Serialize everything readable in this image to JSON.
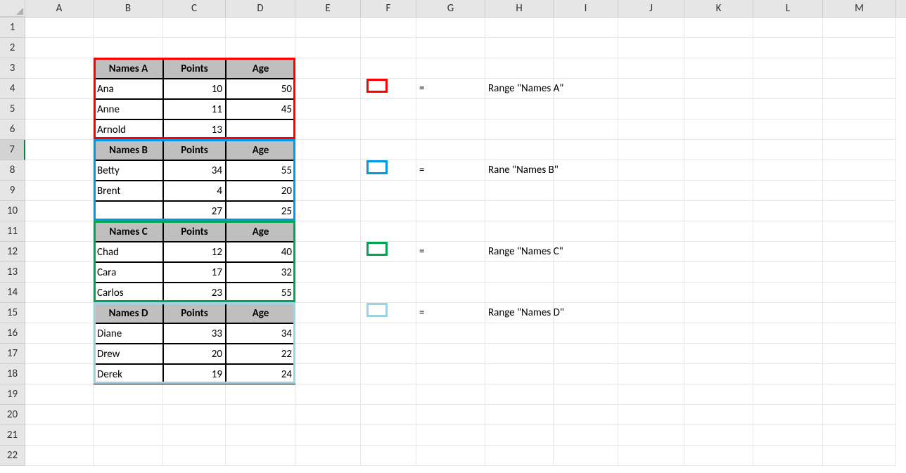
{
  "columns": [
    "A",
    "B",
    "C",
    "D",
    "E",
    "F",
    "G",
    "H",
    "I",
    "J",
    "K",
    "L",
    "M"
  ],
  "col_widths": {
    "A": 97,
    "B": 99,
    "C": 89,
    "D": 99,
    "E": 93,
    "F": 79,
    "G": 98,
    "H": 97,
    "I": 92,
    "J": 94,
    "K": 98,
    "L": 99,
    "M": 104
  },
  "row_count": 22,
  "selected_row": 7,
  "tables": {
    "a": {
      "headers": [
        "Names A",
        "Points",
        "Age"
      ],
      "rows": [
        [
          "Ana",
          "10",
          "50"
        ],
        [
          "Anne",
          "11",
          "45"
        ],
        [
          "Arnold",
          "13",
          ""
        ]
      ]
    },
    "b": {
      "headers": [
        "Names B",
        "Points",
        "Age"
      ],
      "rows": [
        [
          "Betty",
          "34",
          "55"
        ],
        [
          "Brent",
          "4",
          "20"
        ],
        [
          "",
          "27",
          "25"
        ]
      ]
    },
    "c": {
      "headers": [
        "Names C",
        "Points",
        "Age"
      ],
      "rows": [
        [
          "Chad",
          "12",
          "40"
        ],
        [
          "Cara",
          "17",
          "32"
        ],
        [
          "Carlos",
          "23",
          "55"
        ]
      ]
    },
    "d": {
      "headers": [
        "Names D",
        "Points",
        "Age"
      ],
      "rows": [
        [
          "Diane",
          "33",
          "34"
        ],
        [
          "Drew",
          "20",
          "22"
        ],
        [
          "Derek",
          "19",
          "24"
        ]
      ]
    }
  },
  "legend": {
    "equals": "=",
    "a": "Range \"Names A\"",
    "b": "Rane \"Names B\"",
    "c": "Range \"Names C\"",
    "d": "Range \"Names D\""
  },
  "colors": {
    "a": "#ff0000",
    "b": "#0099e6",
    "c": "#00a650",
    "d": "#9cd3e6"
  }
}
